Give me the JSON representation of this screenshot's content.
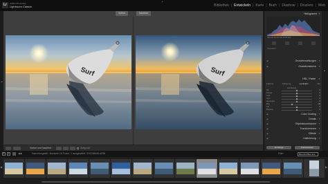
{
  "app": {
    "brand_top": "Adobe Photoshop",
    "brand_name": "Lightroom Classic",
    "logo_text": "Lr"
  },
  "modules": [
    {
      "label": "Bibliothek",
      "active": false
    },
    {
      "label": "Entwickeln",
      "active": true
    },
    {
      "label": "Karte",
      "active": false
    },
    {
      "label": "Buch",
      "active": false
    },
    {
      "label": "Diashow",
      "active": false
    },
    {
      "label": "Drucken",
      "active": false
    },
    {
      "label": "Web",
      "active": false
    }
  ],
  "view": {
    "before_label": "Vorher",
    "after_label": "Nachher"
  },
  "toolbar": {
    "mode_label": "Vorher und Nachher :",
    "softproof_label": "Softproof"
  },
  "histogram": {
    "title": "Histogramm",
    "info": "ISO 100   24 mm   f/11   1/125 Sek.",
    "profile": "Originalbild"
  },
  "panels": {
    "sections_top": [
      {
        "name": "Grundeinstellungen"
      },
      {
        "name": "Gradationskurve"
      }
    ],
    "hsl": {
      "title": "HSL / Farbe",
      "tabs": [
        "Farbton",
        "Sättigung",
        "Luminanz",
        "Alle"
      ],
      "active_tab": "Luminanz",
      "sub_title": "Luminanz",
      "sliders": [
        {
          "label": "Rot",
          "value": "0",
          "pos": 0.5
        },
        {
          "label": "Orange",
          "value": "0",
          "pos": 0.5
        },
        {
          "label": "Gelb",
          "value": "0",
          "pos": 0.5
        },
        {
          "label": "Grün",
          "value": "0",
          "pos": 0.5
        },
        {
          "label": "Aquamarin",
          "value": "0",
          "pos": 0.5
        },
        {
          "label": "Blau",
          "value": "-29",
          "pos": 0.36
        },
        {
          "label": "Lila",
          "value": "0",
          "pos": 0.5
        },
        {
          "label": "Magenta",
          "value": "0",
          "pos": 0.5
        }
      ]
    },
    "sections_bottom": [
      {
        "name": "Color Grading"
      },
      {
        "name": "Details"
      },
      {
        "name": "Objektivkorrekturen"
      },
      {
        "name": "Transformieren"
      },
      {
        "name": "Effekte"
      },
      {
        "name": "Kalibrierung"
      }
    ],
    "prev_button": "Vorherige",
    "reset_button": "Zurücksetzen"
  },
  "filmstrip": {
    "num1": "1",
    "num2": "2",
    "source": "Sammlungsstil : Nordsee   16 Fotos / 1 ausgewählt / DSC06045.ARW",
    "filter_label": "Filter :",
    "filter_value": "Benutzerfilter aus",
    "thumbs": [
      {
        "kind": "beach",
        "selected": false
      },
      {
        "kind": "sunset",
        "selected": false
      },
      {
        "kind": "dunes",
        "selected": false
      },
      {
        "kind": "sky",
        "selected": false
      },
      {
        "kind": "sea",
        "selected": false
      },
      {
        "kind": "blue",
        "selected": false
      },
      {
        "kind": "dunes",
        "selected": false
      },
      {
        "kind": "sea",
        "selected": false
      },
      {
        "kind": "grass",
        "selected": false
      },
      {
        "kind": "buoy",
        "selected": true
      },
      {
        "kind": "beach",
        "selected": false
      },
      {
        "kind": "buoy",
        "selected": false
      },
      {
        "kind": "sunset",
        "selected": false
      },
      {
        "kind": "sea",
        "selected": false
      },
      {
        "kind": "tall",
        "selected": false
      }
    ]
  },
  "colors": {
    "accent": "#e8e8e8",
    "panel_bg": "#282828",
    "view_bg": "#3e3e3e"
  }
}
